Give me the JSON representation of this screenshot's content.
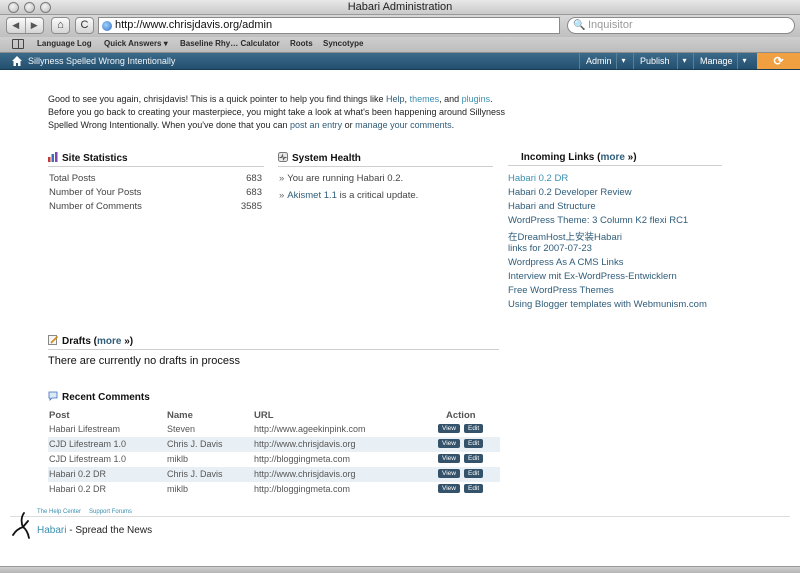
{
  "window": {
    "title": "Habari Administration"
  },
  "browser": {
    "back_label": "◀",
    "forward_label": "▶",
    "home_label": "⌂",
    "reload_label": "C",
    "url": "http://www.chrisjdavis.org/admin",
    "search_placeholder": "Inquisitor",
    "bookmarks": [
      "Language Log",
      "Quick Answers ▾",
      "Baseline Rhy… Calculator",
      "Roots",
      "Syncotype"
    ]
  },
  "adminbar": {
    "site_title": "Sillyness Spelled Wrong Intentionally",
    "menu": [
      "Admin",
      "Publish",
      "Manage"
    ],
    "menu_arrow": "▾",
    "logout_label": "⟳"
  },
  "intro": {
    "part1": "Good to see you again, chrisjdavis! This is a quick pointer to help you find things like ",
    "help": "Help",
    "sep1": ", ",
    "themes": "themes",
    "sep2": ", and ",
    "plugins": "plugins",
    "part2": ". Before you go back to creating your masterpiece, you might take a look at what's been happening around Sillyness Spelled Wrong Intentionally. When you've done that you can ",
    "post_entry": "post an entry",
    "part3": " or ",
    "manage_comments": "manage your comments",
    "part4": "."
  },
  "site_statistics": {
    "title": "Site Statistics",
    "rows": [
      {
        "label": "Total Posts",
        "value": "683"
      },
      {
        "label": "Number of Your Posts",
        "value": "683"
      },
      {
        "label": "Number of Comments",
        "value": "3585"
      }
    ]
  },
  "system_health": {
    "title": "System Health",
    "items": [
      {
        "prefix": "You are running Habari 0.2.",
        "link": "",
        "suffix": ""
      },
      {
        "prefix": "",
        "link": "Akismet 1.1",
        "suffix": " is a critical update."
      }
    ]
  },
  "incoming_links": {
    "title": "Incoming Links (",
    "more": "more",
    "title_end": " »)",
    "links": [
      "Habari 0.2 DR",
      "Habari 0.2 Developer Review",
      "Habari and Structure",
      "WordPress Theme: 3 Column K2 flexi RC1",
      "在DreamHost上安装Habari",
      "links for 2007-07-23",
      "Wordpress As A CMS Links",
      "Interview mit Ex-WordPress-Entwicklern",
      "Free WordPress Themes",
      "Using Blogger templates with Webmunism.com"
    ]
  },
  "drafts": {
    "title": "Drafts (",
    "more": "more",
    "title_end": " »)",
    "message": "There are currently no drafts in process"
  },
  "recent_comments": {
    "title": "Recent Comments",
    "headers": [
      "Post",
      "Name",
      "URL",
      "Action"
    ],
    "view_label": "View",
    "edit_label": "Edit",
    "rows": [
      [
        "Habari Lifestream",
        "Steven",
        "http://www.ageekinpink.com"
      ],
      [
        "CJD Lifestream 1.0",
        "Chris J. Davis",
        "http://www.chrisjdavis.org"
      ],
      [
        "CJD Lifestream 1.0",
        "miklb",
        "http://bloggingmeta.com"
      ],
      [
        "Habari 0.2 DR",
        "Chris J. Davis",
        "http://www.chrisjdavis.org"
      ],
      [
        "Habari 0.2 DR",
        "miklb",
        "http://bloggingmeta.com"
      ]
    ]
  },
  "footer": {
    "links": [
      "The Help Center",
      "Support Forums"
    ],
    "brand": "Habari",
    "tagline": " - Spread the News"
  },
  "colors": {
    "accent": "#3b8fb0",
    "adminbar": "#2d5b7b",
    "logout": "#f0a040"
  }
}
